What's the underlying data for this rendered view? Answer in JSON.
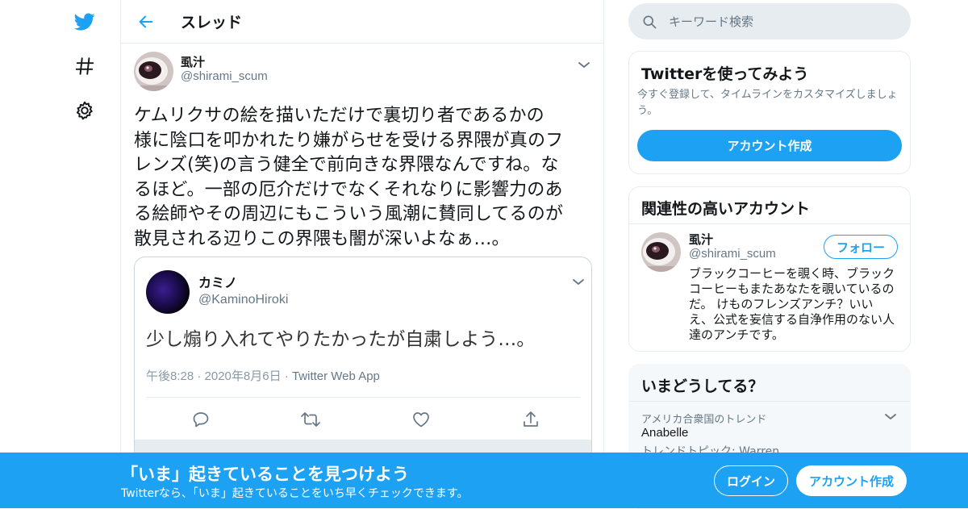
{
  "colors": {
    "accent": "#1da1f2",
    "text": "#14171a",
    "muted": "#657786",
    "border": "#e6ecf0"
  },
  "nav": {
    "icons": [
      "twitter-bird-icon",
      "hashtag-icon",
      "gear-icon"
    ]
  },
  "header": {
    "title": "スレッド"
  },
  "tweet": {
    "display_name": "虱汁",
    "handle": "@shirami_scum",
    "lines": [
      "ケムリクサの絵を描いただけで裏切り者であるかの",
      "様に陰口を叩かれたり嫌がらせを受ける界隈が真のフ",
      "レンズ(笑)の言う健全で前向きな界隈なんですね。な",
      "るほど。一部の厄介だけでなくそれなりに影響力のあ",
      "る絵師やその周辺にもこういう風潮に賛同してるのが",
      "散見される辺りこの界隈も闇が深いよなぁ…。"
    ]
  },
  "quote": {
    "display_name": "カミノ",
    "handle": "@KaminoHiroki",
    "text": "少し煽り入れてやりたかったが自粛しよう…。",
    "timestamp": "午後8:28 · 2020年8月6日",
    "sep": " · ",
    "source": "Twitter Web App",
    "actions": [
      "reply-icon",
      "retweet-icon",
      "like-icon",
      "share-icon"
    ]
  },
  "search": {
    "placeholder": "キーワード検索"
  },
  "signup_card": {
    "title": "Twitterを使ってみよう",
    "desc_lines": [
      "今すぐ登録して、タイムラインをカスタマイズしましょ",
      "う。"
    ],
    "button": "アカウント作成"
  },
  "related": {
    "title": "関連性の高いアカウント",
    "display_name": "虱汁",
    "handle": "@shirami_scum",
    "follow_label": "フォロー",
    "bio_lines": [
      "ブラックコーヒーを覗く時、ブラック",
      "コーヒーもまたあなたを覗いているの",
      "だ。 けものフレンズアンチ？いい",
      "え、公式を妄信する自浄作用のない人",
      "達のアンチです。"
    ]
  },
  "trends": {
    "title": "いまどうしてる？",
    "context": "アメリカ合衆国のトレンド",
    "name": "Anabelle",
    "topic": "トレンドトピック: Warren"
  },
  "banner": {
    "headline": "「いま」起きていることを見つけよう",
    "sub": "Twitterなら、「いま」起きていることをいち早くチェックできます。",
    "login": "ログイン",
    "signup": "アカウント作成"
  }
}
